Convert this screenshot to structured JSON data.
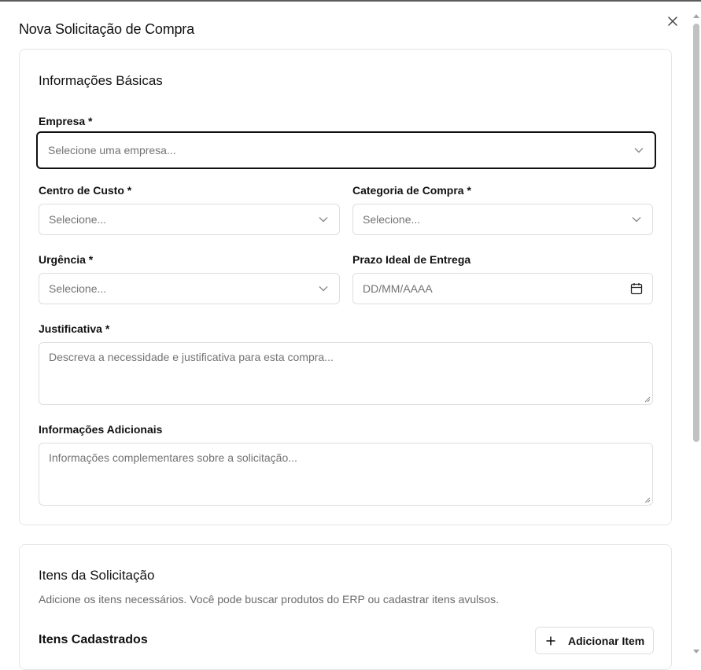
{
  "dialog": {
    "title": "Nova Solicitação de Compra",
    "close_icon": "close-icon"
  },
  "basic_info": {
    "title": "Informações Básicas",
    "empresa": {
      "label": "Empresa *",
      "placeholder": "Selecione uma empresa..."
    },
    "centro_custo": {
      "label": "Centro de Custo *",
      "placeholder": "Selecione..."
    },
    "categoria": {
      "label": "Categoria de Compra *",
      "placeholder": "Selecione..."
    },
    "urgencia": {
      "label": "Urgência *",
      "placeholder": "Selecione..."
    },
    "prazo": {
      "label": "Prazo Ideal de Entrega",
      "placeholder": "DD/MM/AAAA"
    },
    "justificativa": {
      "label": "Justificativa *",
      "placeholder": "Descreva a necessidade e justificativa para esta compra..."
    },
    "info_adicionais": {
      "label": "Informações Adicionais",
      "placeholder": "Informações complementares sobre a solicitação..."
    }
  },
  "items": {
    "title": "Itens da Solicitação",
    "description": "Adicione os itens necessários. Você pode buscar produtos do ERP ou cadastrar itens avulsos.",
    "registered_title": "Itens Cadastrados",
    "add_button": "Adicionar Item"
  },
  "colors": {
    "focus_border": "#111111",
    "border": "#dedede",
    "placeholder": "#737373"
  }
}
